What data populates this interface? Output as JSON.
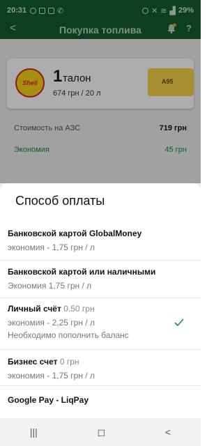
{
  "status_bar": {
    "time": "20:31",
    "battery": "29%"
  },
  "header": {
    "back_icon": "arrow-left-icon",
    "title": "Покупка топлива",
    "help": "?"
  },
  "coupon": {
    "brand_logo_text": "Shell",
    "count": "1",
    "unit": "талон",
    "price_line": "674 грн / 20 л",
    "fuel_type": "A95"
  },
  "summary": {
    "cost_label": "Стоимость на АЗС",
    "cost_value": "719 грн",
    "savings_label": "Экономия",
    "savings_value": "45 грн"
  },
  "sheet": {
    "title": "Способ оплаты",
    "options": [
      {
        "name": "Банковской картой GlobalMoney",
        "sub": "экономия - 1,75 грн / л"
      },
      {
        "name": "Банковской картой или наличными",
        "sub": "Экономия 1,75 грн / л"
      },
      {
        "name": "Личный счёт",
        "balance": "0.50 грн",
        "sub": "экономия - 2,25 грн / л",
        "note": "Необходимо пополнить баланс",
        "selected": true
      },
      {
        "name": "Бизнес счет",
        "balance": "0 грн",
        "sub": "экономия - 1,75 грн / л"
      },
      {
        "name": "Google Pay - LiqPay"
      }
    ]
  },
  "colors": {
    "brand_green": "#145e2e",
    "accent_green": "#1c8a3c",
    "notification_dot": "#f0a020"
  }
}
